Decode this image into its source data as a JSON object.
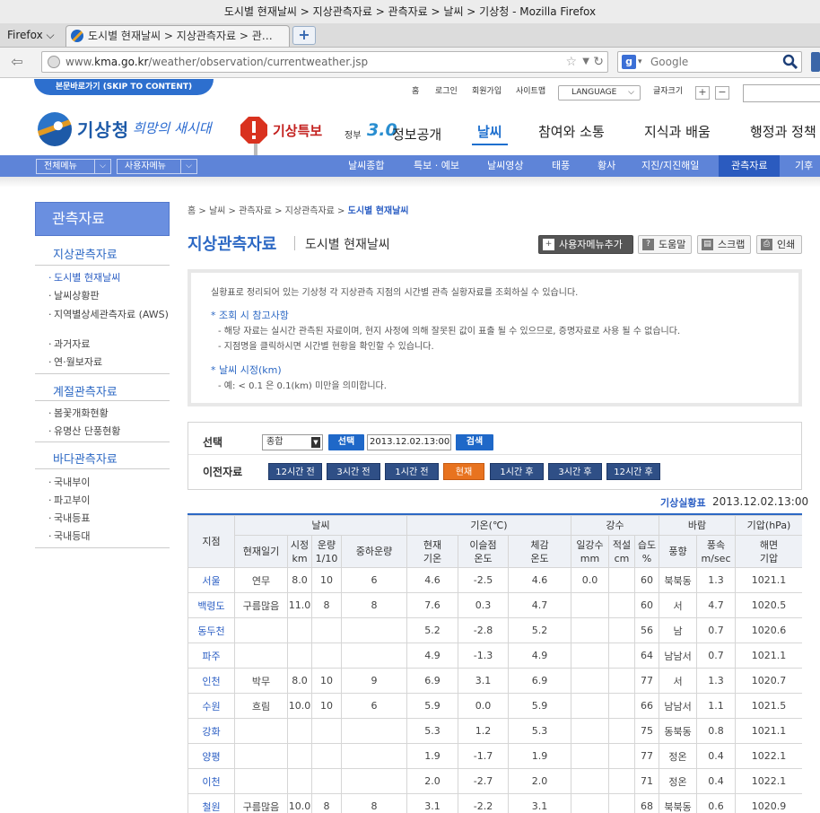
{
  "window": {
    "title": "도시별 현재날씨 > 지상관측자료 > 관측자료 > 날씨 > 기상청 - Mozilla Firefox"
  },
  "browser": {
    "menu_label": "Firefox",
    "tab_title": "도시별 현재날씨 > 지상관측자료 > 관…",
    "url_prefix": "www.",
    "url_domain": "kma.go.kr",
    "url_path": "/weather/observation/currentweather.jsp",
    "search_placeholder": "Google"
  },
  "util": {
    "skip": "본문바로가기 (SKIP TO CONTENT)",
    "home": "홈",
    "login": "로그인",
    "join": "회원가입",
    "sitemap": "사이트맵",
    "language": "LANGUAGE",
    "fontsize": "글자크기",
    "plus": "+",
    "minus": "−"
  },
  "header": {
    "logo": "기상청",
    "slogan": "희망의 새시대",
    "warning": "기상특보",
    "gov_prefix": "정부",
    "gov_version": "3.0",
    "open_info": "정보공개",
    "gnb": [
      "날씨",
      "참여와 소통",
      "지식과 배움",
      "행정과 정책"
    ]
  },
  "subnav": {
    "all_menu": "전체메뉴",
    "user_menu": "사용자메뉴",
    "items": [
      "날씨종합",
      "특보 · 예보",
      "날씨영상",
      "태풍",
      "황사",
      "지진/지진해일",
      "관측자료",
      "기후자"
    ]
  },
  "sidebar": {
    "title": "관측자료",
    "sections": [
      {
        "title": "지상관측자료",
        "items": [
          "도시별 현재날씨",
          "날씨상황판",
          "지역별상세관측자료 (AWS)",
          "과거자료",
          "연·월보자료"
        ]
      },
      {
        "title": "계절관측자료",
        "items": [
          "봄꽃개화현황",
          "유명산 단풍현황"
        ]
      },
      {
        "title": "바다관측자료",
        "items": [
          "국내부이",
          "파고부이",
          "국내등표",
          "국내등대"
        ]
      }
    ]
  },
  "breadcrumb": {
    "home": "홈",
    "p1": "날씨",
    "p2": "관측자료",
    "p3": "지상관측자료",
    "current": "도시별 현재날씨"
  },
  "page": {
    "title": "지상관측자료",
    "subtitle": "도시별 현재날씨"
  },
  "tools": {
    "add": "사용자메뉴추가",
    "help": "도움말",
    "scrap": "스크랩",
    "print": "인쇄"
  },
  "info": {
    "intro": "실황표로 정리되어 있는 기상청 각 지상관측 지점의 시간별 관측 실황자료를 조회하실 수 있습니다.",
    "note_title": "* 조회 시 참고사항",
    "note1": "- 해당 자료는 실시간 관측된 자료이며, 현지 사정에 의해 잘못된 값이 표출 될 수 있으므로, 증명자료로 사용 될 수 없습니다.",
    "note2": "- 지점명을 클릭하시면 시간별 현황을 확인할 수 있습니다.",
    "vis_title": "* 날씨 시정(km)",
    "vis1": "- 예: < 0.1 은 0.1(km) 미만을 의미합니다."
  },
  "select": {
    "label": "선택",
    "option": "종합",
    "select_btn": "선택",
    "datetime": "2013.12.02.13:00",
    "search_btn": "검색",
    "prev_label": "이전자료",
    "time_buttons": [
      "12시간 전",
      "3시간 전",
      "1시간 전",
      "현재",
      "1시간 후",
      "3시간 후",
      "12시간 후"
    ]
  },
  "obs": {
    "label": "기상실황표",
    "time": "2013.12.02.13:00"
  },
  "table": {
    "groups": {
      "station": "지점",
      "weather": "날씨",
      "temp": "기온(℃)",
      "precip": "강수",
      "wind": "바람",
      "pressure": "기압(hPa)"
    },
    "sub": {
      "current": "현재일기",
      "vis": "시정\nkm",
      "cloud": "운량\n1/10",
      "mid_cloud": "중하운량",
      "temp_now": "현재\n기온",
      "dew": "이슬점\n온도",
      "feel": "체감\n온도",
      "rain": "일강수\nmm",
      "snow": "적설\ncm",
      "hum": "습도\n%",
      "wdir": "풍향",
      "wspd": "풍속\nm/sec",
      "sea": "해면\n기압"
    },
    "rows": [
      {
        "st": "서울",
        "wx": "연무",
        "vis": "8.0",
        "cl": "10",
        "mc": "6",
        "t": "4.6",
        "dp": "-2.5",
        "ft": "4.6",
        "rn": "0.0",
        "sn": "",
        "hm": "60",
        "wd": "북북동",
        "ws": "1.3",
        "pr": "1021.1"
      },
      {
        "st": "백령도",
        "wx": "구름많음",
        "vis": "11.0",
        "cl": "8",
        "mc": "8",
        "t": "7.6",
        "dp": "0.3",
        "ft": "4.7",
        "rn": "",
        "sn": "",
        "hm": "60",
        "wd": "서",
        "ws": "4.7",
        "pr": "1020.5"
      },
      {
        "st": "동두천",
        "wx": "",
        "vis": "",
        "cl": "",
        "mc": "",
        "t": "5.2",
        "dp": "-2.8",
        "ft": "5.2",
        "rn": "",
        "sn": "",
        "hm": "56",
        "wd": "남",
        "ws": "0.7",
        "pr": "1020.6"
      },
      {
        "st": "파주",
        "wx": "",
        "vis": "",
        "cl": "",
        "mc": "",
        "t": "4.9",
        "dp": "-1.3",
        "ft": "4.9",
        "rn": "",
        "sn": "",
        "hm": "64",
        "wd": "남남서",
        "ws": "0.7",
        "pr": "1021.1"
      },
      {
        "st": "인천",
        "wx": "박무",
        "vis": "8.0",
        "cl": "10",
        "mc": "9",
        "t": "6.9",
        "dp": "3.1",
        "ft": "6.9",
        "rn": "",
        "sn": "",
        "hm": "77",
        "wd": "서",
        "ws": "1.3",
        "pr": "1020.7"
      },
      {
        "st": "수원",
        "wx": "흐림",
        "vis": "10.0",
        "cl": "10",
        "mc": "6",
        "t": "5.9",
        "dp": "0.0",
        "ft": "5.9",
        "rn": "",
        "sn": "",
        "hm": "66",
        "wd": "남남서",
        "ws": "1.1",
        "pr": "1021.5"
      },
      {
        "st": "강화",
        "wx": "",
        "vis": "",
        "cl": "",
        "mc": "",
        "t": "5.3",
        "dp": "1.2",
        "ft": "5.3",
        "rn": "",
        "sn": "",
        "hm": "75",
        "wd": "동북동",
        "ws": "0.8",
        "pr": "1021.1"
      },
      {
        "st": "양평",
        "wx": "",
        "vis": "",
        "cl": "",
        "mc": "",
        "t": "1.9",
        "dp": "-1.7",
        "ft": "1.9",
        "rn": "",
        "sn": "",
        "hm": "77",
        "wd": "정온",
        "ws": "0.4",
        "pr": "1022.1"
      },
      {
        "st": "이천",
        "wx": "",
        "vis": "",
        "cl": "",
        "mc": "",
        "t": "2.0",
        "dp": "-2.7",
        "ft": "2.0",
        "rn": "",
        "sn": "",
        "hm": "71",
        "wd": "정온",
        "ws": "0.4",
        "pr": "1022.1"
      },
      {
        "st": "철원",
        "wx": "구름많음",
        "vis": "10.0",
        "cl": "8",
        "mc": "8",
        "t": "3.1",
        "dp": "-2.2",
        "ft": "3.1",
        "rn": "",
        "sn": "",
        "hm": "68",
        "wd": "북북동",
        "ws": "0.6",
        "pr": "1020.9"
      }
    ]
  },
  "colors": {
    "accent": "#2c68c4",
    "subnav": "#5e84d8",
    "warning": "#c3211f",
    "now_button": "#e8731f"
  }
}
